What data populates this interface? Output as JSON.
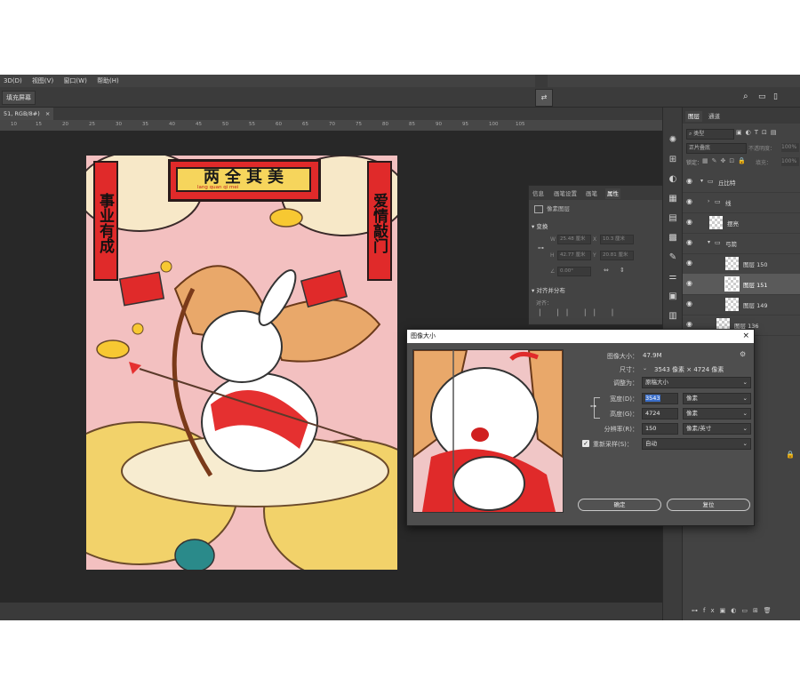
{
  "menubar": {
    "items": [
      "3D(D)",
      "视图(V)",
      "窗口(W)",
      "帮助(H)"
    ]
  },
  "options_bar": {
    "fill_screen_label": "填充屏幕"
  },
  "document": {
    "tab_label": "51, RGB/8#)",
    "ruler_ticks": [
      "10",
      "15",
      "20",
      "25",
      "30",
      "35",
      "40",
      "45",
      "50",
      "55",
      "60",
      "65",
      "70",
      "75",
      "80",
      "85",
      "90",
      "95",
      "100",
      "105"
    ]
  },
  "artwork": {
    "banner_text": "两全其美",
    "banner_subtext": "lang quan qi mei",
    "left_couplet": "事业有成",
    "right_couplet": "爱情敲门"
  },
  "properties_panel": {
    "tabs": [
      "信息",
      "画笔设置",
      "画笔",
      "属性"
    ],
    "active_tab": "属性",
    "layer_type": "像素图层",
    "transform_title": "变换",
    "w_label": "W",
    "w_value": "25.48 厘米",
    "h_label": "H",
    "h_value": "42.77 厘米",
    "x_label": "X",
    "x_value": "10.3 厘米",
    "y_label": "Y",
    "y_value": "20.81 厘米",
    "angle_value": "0.00°",
    "align_title": "对齐并分布",
    "align_sub": "对齐："
  },
  "layers_panel": {
    "tabs": [
      "图层",
      "通道"
    ],
    "kind_filter": "类型",
    "blend_mode": "正片叠底",
    "opacity_label": "不透明度：",
    "opacity_value": "100%",
    "lock_label": "锁定：",
    "fill_label": "填充：",
    "fill_value": "100%",
    "layers": [
      {
        "name": "丘比特",
        "type": "group",
        "indent": 0
      },
      {
        "name": "线",
        "type": "group",
        "indent": 1
      },
      {
        "name": "摆亮",
        "type": "layer",
        "indent": 1
      },
      {
        "name": "弓箭",
        "type": "group",
        "indent": 1
      },
      {
        "name": "图层 150",
        "type": "layer",
        "indent": 2
      },
      {
        "name": "图层 151",
        "type": "layer",
        "indent": 2
      },
      {
        "name": "图层 149",
        "type": "layer",
        "indent": 2
      },
      {
        "name": "图层 136",
        "type": "layer",
        "indent": 1
      }
    ]
  },
  "dialog": {
    "title": "图像大小",
    "image_size_label": "图像大小：",
    "image_size_value": "47.9M",
    "dimensions_label": "尺寸：",
    "dimensions_value": "3543 像素 × 4724 像素",
    "fit_to_label": "调整为：",
    "fit_to_value": "原稿大小",
    "width_label": "宽度(D)：",
    "width_value": "3543",
    "width_unit": "像素",
    "height_label": "高度(G)：",
    "height_value": "4724",
    "height_unit": "像素",
    "resolution_label": "分辨率(R)：",
    "resolution_value": "150",
    "resolution_unit": "像素/英寸",
    "resample_label": "重新采样(S)：",
    "resample_value": "自动",
    "resample_checked": true,
    "ok_label": "确定",
    "reset_label": "复位"
  }
}
